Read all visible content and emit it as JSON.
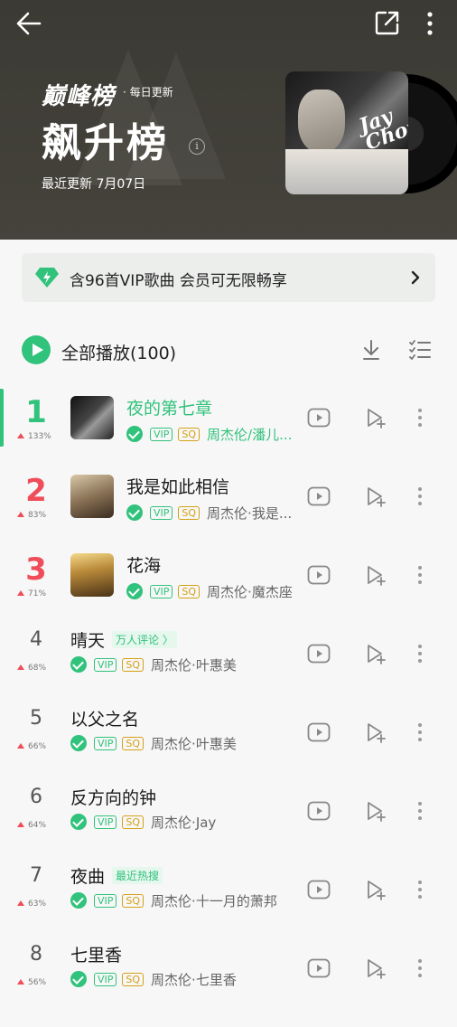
{
  "header": {
    "brand": "巅峰榜",
    "brand_sub": "· 每日更新",
    "title": "飙升榜",
    "updated": "最近更新 7月07日",
    "cover_text": "Jay Chou"
  },
  "vip_banner": {
    "text": "含96首VIP歌曲 会员可无限畅享"
  },
  "play_all": {
    "label": "全部播放(100)"
  },
  "colors": {
    "accent": "#31c27c",
    "rank_red": "#ef4d5a",
    "sq_gold": "#d4a017",
    "header_bg": "#3e3d36"
  },
  "songs": [
    {
      "rank": "1",
      "trend": "133%",
      "title": "夜的第七章",
      "artist": "周杰伦/潘儿...",
      "tag": ""
    },
    {
      "rank": "2",
      "trend": "83%",
      "title": "我是如此相信",
      "artist": "周杰伦·我是...",
      "tag": ""
    },
    {
      "rank": "3",
      "trend": "71%",
      "title": "花海",
      "artist": "周杰伦·魔杰座",
      "tag": ""
    },
    {
      "rank": "4",
      "trend": "68%",
      "title": "晴天",
      "artist": "周杰伦·叶惠美",
      "tag": "万人评论 〉"
    },
    {
      "rank": "5",
      "trend": "66%",
      "title": "以父之名",
      "artist": "周杰伦·叶惠美",
      "tag": ""
    },
    {
      "rank": "6",
      "trend": "64%",
      "title": "反方向的钟",
      "artist": "周杰伦·Jay",
      "tag": ""
    },
    {
      "rank": "7",
      "trend": "63%",
      "title": "夜曲",
      "artist": "周杰伦·十一月的萧邦",
      "tag": "最近热搜"
    },
    {
      "rank": "8",
      "trend": "56%",
      "title": "七里香",
      "artist": "周杰伦·七里香",
      "tag": ""
    }
  ],
  "badges": {
    "vip": "VIP",
    "sq": "SQ"
  },
  "icons": [
    "back-arrow-icon",
    "share-icon",
    "more-vertical-icon",
    "diamond-icon",
    "chevron-right-icon",
    "play-circle-icon",
    "download-icon",
    "multi-select-icon",
    "mv-play-icon",
    "add-to-playlist-icon",
    "check-circle-icon"
  ]
}
